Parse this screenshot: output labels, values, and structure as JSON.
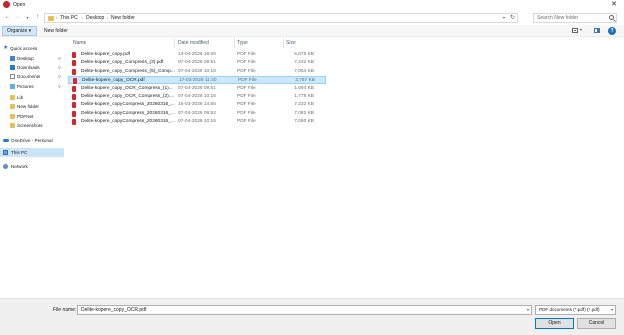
{
  "window": {
    "title": "Open",
    "app_icon_letter": ""
  },
  "navigation": {
    "breadcrumbs": [
      "This PC",
      "Desktop",
      "New folder"
    ],
    "search_placeholder": "Search New folder"
  },
  "toolbar": {
    "organize_label": "Organize ▾",
    "new_folder_label": "New folder"
  },
  "sidebar": {
    "items": [
      {
        "label": "Quick access",
        "icon": "star-icon",
        "pinned": false
      },
      {
        "label": "Desktop",
        "icon": "desktop-icon",
        "pinned": true
      },
      {
        "label": "Downloads",
        "icon": "download-icon",
        "pinned": true
      },
      {
        "label": "Documents",
        "icon": "documents-icon",
        "pinned": true
      },
      {
        "label": "Pictures",
        "icon": "pictures-icon",
        "pinned": true
      },
      {
        "label": "Lib",
        "icon": "folder-icon",
        "pinned": false
      },
      {
        "label": "New folder",
        "icon": "folder-icon",
        "pinned": false
      },
      {
        "label": "PDFNet",
        "icon": "folder-icon",
        "pinned": false
      },
      {
        "label": "Screenshots",
        "icon": "folder-icon",
        "pinned": false
      },
      {
        "label": "OneDrive - Personal",
        "icon": "onedrive-icon",
        "pinned": false
      },
      {
        "label": "This PC",
        "icon": "computer-icon",
        "pinned": false
      },
      {
        "label": "Network",
        "icon": "network-icon",
        "pinned": false
      }
    ],
    "selected": "This PC"
  },
  "file_list": {
    "columns": [
      "Name",
      "Date modified",
      "Type",
      "Size"
    ],
    "rows": [
      {
        "name": "Delite-kopere_copy.pdf",
        "date": "13-04-2026 16:00",
        "type": "PDF File",
        "size": "6,675 KB"
      },
      {
        "name": "Delite-kopere_copy_Compress_(3).pdf",
        "date": "07-04-2026 09:51",
        "type": "PDF File",
        "size": "7,232 KB"
      },
      {
        "name": "Delite-kopere_copy_Compress_(5)_Comp...",
        "date": "07-04-2026 10:16",
        "type": "PDF File",
        "size": "7,064 KB"
      },
      {
        "name": "Delite-kopere_copy_OCR.pdf",
        "date": "17-03-2026 11:40",
        "type": "PDF File",
        "size": "3,767 KB"
      },
      {
        "name": "Delite-kopere_copy_OCR_Compress_(1)...",
        "date": "07-04-2026 09:51",
        "type": "PDF File",
        "size": "1,094 KB"
      },
      {
        "name": "Delite-kopere_copy_OCR_Compress_(2)....",
        "date": "07-04-2026 10:16",
        "type": "PDF File",
        "size": "1,778 KB"
      },
      {
        "name": "Delite-kopere_copyCompress_20260316_...",
        "date": "16-03-2026 14:56",
        "type": "PDF File",
        "size": "7,232 KB"
      },
      {
        "name": "Delite-kopere_copyCompress_20260316_...",
        "date": "07-04-2026 09:52",
        "type": "PDF File",
        "size": "7,082 KB"
      },
      {
        "name": "Delite-kopere_copyCompress_20260316_...",
        "date": "07-04-2026 10:16",
        "type": "PDF File",
        "size": "7,060 KB"
      }
    ],
    "selected_index": 3
  },
  "footer": {
    "file_name_label": "File name:",
    "file_name_value": "Delite-kopere_copy_OCR.pdf",
    "file_type_value": "PDF documents (*.pdf) (*.pdf)",
    "open_label": "Open",
    "cancel_label": "Cancel"
  }
}
